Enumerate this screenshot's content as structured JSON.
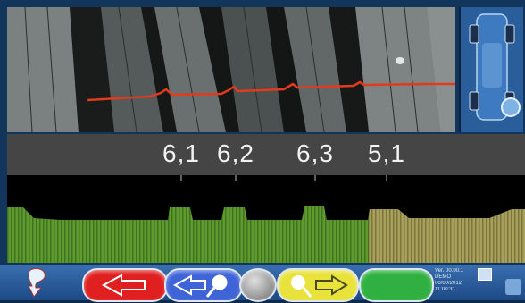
{
  "tread_readings": [
    "6,1",
    "6,2",
    "6,3",
    "5,1"
  ],
  "profile": {
    "green_color": "#5f9a2e",
    "yellow_color": "#a7a05a",
    "laser_color": "#e23a1e"
  },
  "toolbar": {
    "back_button_color": "#e02020",
    "magnify_back_color": "#3f64d8",
    "round_button_color": "#9a9a9a",
    "magnify_forward_color": "#e8e23a",
    "confirm_button_color": "#2fb040"
  },
  "status": {
    "line1": "Ver. 00.00.1",
    "line2": "DEMO",
    "line3": "00/00/2012",
    "line4": "11:00:31"
  }
}
